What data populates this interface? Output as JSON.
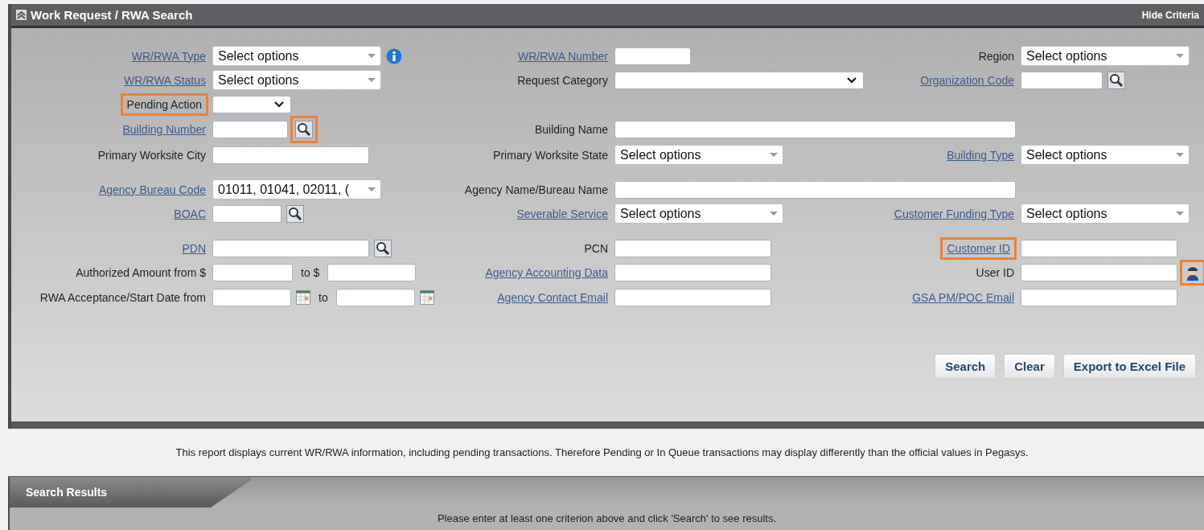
{
  "header": {
    "title": "Work Request / RWA Search",
    "hide_link": "Hide Criteria"
  },
  "groups": [
    {
      "rows": [
        {
          "left": {
            "label": "WR/RWA Type",
            "link": true,
            "highlighted": false,
            "controls": [
              {
                "kind": "multiselect",
                "value": "Select options"
              },
              {
                "kind": "info",
                "highlighted": false
              }
            ]
          },
          "middle": {
            "label": "WR/RWA Number",
            "link": true,
            "highlighted": false,
            "controls": [
              {
                "kind": "input"
              }
            ]
          },
          "right": {
            "label": "Region",
            "link": false,
            "highlighted": false,
            "controls": [
              {
                "kind": "multiselect",
                "value": "Select options"
              }
            ]
          }
        },
        {
          "left": {
            "label": "WR/RWA Status",
            "link": true,
            "highlighted": false,
            "controls": [
              {
                "kind": "multiselect",
                "value": "Select options"
              }
            ]
          },
          "middle": {
            "label": "Request Category",
            "link": false,
            "highlighted": false,
            "controls": [
              {
                "kind": "select"
              }
            ]
          },
          "right": {
            "label": "Organization Code",
            "link": true,
            "highlighted": false,
            "controls": [
              {
                "kind": "input"
              },
              {
                "kind": "lookup",
                "highlighted": false
              }
            ]
          }
        },
        {
          "left": {
            "label": "Pending Action",
            "link": false,
            "highlighted": true,
            "controls": [
              {
                "kind": "select"
              }
            ]
          }
        },
        {
          "left": {
            "label": "Building Number",
            "link": true,
            "highlighted": false,
            "controls": [
              {
                "kind": "input"
              },
              {
                "kind": "lookup",
                "highlighted": true
              }
            ]
          },
          "middle": {
            "label": "Building Name",
            "link": false,
            "highlighted": false,
            "controls": [
              {
                "kind": "input"
              }
            ]
          }
        },
        {
          "left": {
            "label": "Primary Worksite City",
            "link": false,
            "highlighted": false,
            "controls": [
              {
                "kind": "input"
              }
            ]
          },
          "middle": {
            "label": "Primary Worksite State",
            "link": false,
            "highlighted": false,
            "controls": [
              {
                "kind": "multiselect",
                "value": "Select options"
              }
            ]
          },
          "right": {
            "label": "Building Type",
            "link": true,
            "highlighted": false,
            "controls": [
              {
                "kind": "multiselect",
                "value": "Select options"
              }
            ]
          }
        }
      ]
    },
    {
      "rows": [
        {
          "left": {
            "label": "Agency Bureau Code",
            "link": true,
            "highlighted": false,
            "controls": [
              {
                "kind": "multiselect",
                "value": "01011, 01041, 02011, ("
              }
            ]
          },
          "middle": {
            "label": "Agency Name/Bureau Name",
            "link": false,
            "highlighted": false,
            "controls": [
              {
                "kind": "input"
              }
            ]
          }
        },
        {
          "left": {
            "label": "BOAC",
            "link": true,
            "highlighted": false,
            "controls": [
              {
                "kind": "input"
              },
              {
                "kind": "lookup",
                "highlighted": false
              }
            ]
          },
          "middle": {
            "label": "Severable Service",
            "link": true,
            "highlighted": false,
            "controls": [
              {
                "kind": "multiselect",
                "value": "Select options"
              }
            ]
          },
          "right": {
            "label": "Customer Funding Type",
            "link": true,
            "highlighted": false,
            "controls": [
              {
                "kind": "multiselect",
                "value": "Select options"
              }
            ]
          }
        }
      ]
    },
    {
      "rows": [
        {
          "left": {
            "label": "PDN",
            "link": true,
            "highlighted": false,
            "controls": [
              {
                "kind": "input"
              },
              {
                "kind": "lookup",
                "highlighted": false
              }
            ]
          },
          "middle": {
            "label": "PCN",
            "link": false,
            "highlighted": false,
            "controls": [
              {
                "kind": "input"
              }
            ]
          },
          "right": {
            "label": "Customer ID",
            "link": true,
            "highlighted": true,
            "controls": [
              {
                "kind": "input"
              }
            ]
          }
        },
        {
          "left": {
            "label": "Authorized Amount from $",
            "link": false,
            "highlighted": false,
            "controls": [
              {
                "kind": "input"
              },
              {
                "kind": "text",
                "text": "to $"
              },
              {
                "kind": "input"
              }
            ]
          },
          "middle": {
            "label": "Agency Accounting Data",
            "link": true,
            "highlighted": false,
            "controls": [
              {
                "kind": "input"
              }
            ]
          },
          "right": {
            "label": "User ID",
            "link": false,
            "highlighted": false,
            "controls": [
              {
                "kind": "input"
              },
              {
                "kind": "user",
                "highlighted": true
              }
            ]
          }
        },
        {
          "left": {
            "label": "RWA Acceptance/Start Date  from",
            "link": false,
            "highlighted": false,
            "controls": [
              {
                "kind": "input"
              },
              {
                "kind": "calendar",
                "highlighted": false
              },
              {
                "kind": "text",
                "text": "to"
              },
              {
                "kind": "input"
              },
              {
                "kind": "calendar",
                "highlighted": false
              }
            ]
          },
          "middle": {
            "label": "Agency Contact Email",
            "link": true,
            "highlighted": false,
            "controls": [
              {
                "kind": "input"
              }
            ]
          },
          "right": {
            "label": "GSA PM/POC Email",
            "link": true,
            "highlighted": false,
            "controls": [
              {
                "kind": "input"
              }
            ]
          }
        }
      ]
    }
  ],
  "buttons": [
    "Search",
    "Clear",
    "Export to Excel File"
  ],
  "notice": "This report displays current WR/RWA information, including pending transactions. Therefore Pending or In Queue transactions may display differently than the official values in Pegasys.",
  "results": {
    "title": "Search Results",
    "message": "Please enter at least one criterion above and click 'Search' to see results."
  }
}
